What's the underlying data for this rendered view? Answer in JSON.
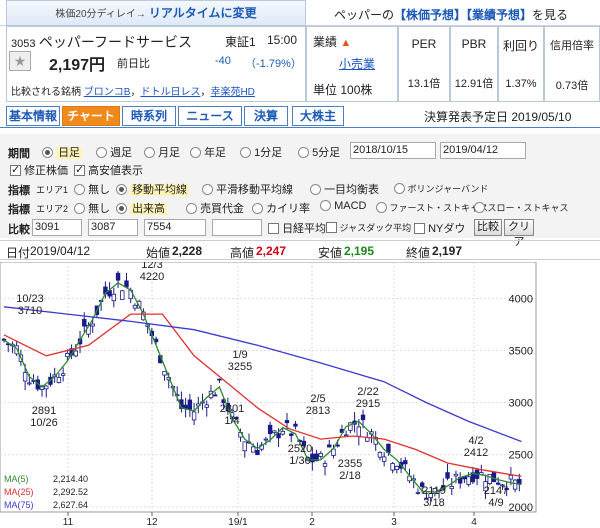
{
  "header": {
    "delay_note": "株価20分ディレイ→",
    "realtime_link": "リアルタイムに変更",
    "forecast_prefix": "ペッパーの",
    "stock_forecast_link": "【株価予想】",
    "earnings_forecast_link": "【業績予想】",
    "forecast_suffix": "を見る"
  },
  "quote": {
    "code": "3053",
    "name": "ペッパーフードサービス",
    "market": "東証1",
    "time": "15:00",
    "price": "2,197円",
    "change_label": "前日比",
    "change": "-40",
    "change_pct": "（-1.79%）",
    "compare_label": "比較される銘柄",
    "compare_stocks": [
      "ブロンコB",
      "ドトル日レス",
      "幸楽苑HD"
    ],
    "sector_label": "業績",
    "sector_value": "小売業",
    "unit_label": "単位",
    "unit_value": "100株"
  },
  "metrics": {
    "headers": [
      "PER",
      "PBR",
      "利回り",
      "信用倍率"
    ],
    "values": [
      "13.1倍",
      "12.91倍",
      "1.37%",
      "0.73倍"
    ]
  },
  "tabs": [
    "基本情報",
    "チャート",
    "時系列",
    "ニュース",
    "決算",
    "大株主"
  ],
  "earnings_date": "決算発表予定日 2019/05/10",
  "controls": {
    "period_label": "期間",
    "periods": [
      "日足",
      "週足",
      "月足",
      "年足",
      "1分足",
      "5分足"
    ],
    "date_from": "2018/10/15",
    "date_to": "2019/04/12",
    "adjusted_label": "修正株価",
    "hilo_label": "高安値表示",
    "indicator_label": "指標",
    "area1": "エリア1",
    "area1_options": [
      "無し",
      "移動平均線",
      "平滑移動平均線",
      "一目均衡表",
      "ボリンジャーバンド"
    ],
    "area2": "エリア2",
    "area2_options": [
      "無し",
      "出来高",
      "売買代金",
      "カイリ率",
      "MACD",
      "ファースト・ストキャス",
      "スロー・ストキャス"
    ],
    "compare_label": "比較",
    "compare_codes": [
      "3091",
      "3087",
      "7554",
      ""
    ],
    "nikkei_label": "日経平均",
    "jasdaq_label": "ジャスダック平均",
    "ny_label": "NYダウ",
    "compare_btn": "比較",
    "clear_btn": "クリア"
  },
  "ohlc": {
    "date_label": "日付",
    "date": "2019/04/12",
    "open_label": "始値",
    "open": "2,228",
    "high_label": "高値",
    "high": "2,247",
    "low_label": "安値",
    "low": "2,195",
    "close_label": "終値",
    "close": "2,197"
  },
  "chart_data": {
    "type": "line",
    "y_ticks": [
      "4000",
      "3500",
      "3000",
      "2500",
      "2000"
    ],
    "ylim": [
      1950,
      4350
    ],
    "x_labels": [
      "11",
      "12",
      "19/1",
      "2",
      "3",
      "4"
    ],
    "annotations": [
      {
        "label": "10/23",
        "value": "3710"
      },
      {
        "label": "2891",
        "value": "10/26"
      },
      {
        "label": "12/3",
        "value": "4220"
      },
      {
        "label": "1/9",
        "value": "3255"
      },
      {
        "label": "2801",
        "value": "1/4"
      },
      {
        "label": "2/5",
        "value": "2813"
      },
      {
        "label": "2520",
        "value": "1/30"
      },
      {
        "label": "2/22",
        "value": "2915"
      },
      {
        "label": "2355",
        "value": "2/18"
      },
      {
        "label": "4/2",
        "value": "2412"
      },
      {
        "label": "2119",
        "value": "3/18"
      },
      {
        "label": "2147",
        "value": "4/9"
      }
    ],
    "ma_legend": [
      {
        "name": "MA(5)",
        "value": "2,214.40",
        "color": "#2e8b2e"
      },
      {
        "name": "MA(25)",
        "value": "2,292.52",
        "color": "#e03030"
      },
      {
        "name": "MA(75)",
        "value": "2,627.64",
        "color": "#3a3ad0"
      }
    ],
    "series": [
      {
        "name": "MA(5)",
        "color": "#2e8b2e",
        "points": [
          [
            0,
            3600
          ],
          [
            6,
            3520
          ],
          [
            12,
            3250
          ],
          [
            18,
            3150
          ],
          [
            24,
            3250
          ],
          [
            30,
            3400
          ],
          [
            36,
            3600
          ],
          [
            42,
            3800
          ],
          [
            48,
            4050
          ],
          [
            54,
            4150
          ],
          [
            60,
            4080
          ],
          [
            66,
            3850
          ],
          [
            72,
            3550
          ],
          [
            78,
            3250
          ],
          [
            84,
            2950
          ],
          [
            90,
            2920
          ],
          [
            96,
            3050
          ],
          [
            102,
            3150
          ],
          [
            108,
            2850
          ],
          [
            114,
            2650
          ],
          [
            120,
            2560
          ],
          [
            126,
            2640
          ],
          [
            132,
            2760
          ],
          [
            138,
            2700
          ],
          [
            144,
            2450
          ],
          [
            150,
            2450
          ],
          [
            156,
            2560
          ],
          [
            162,
            2770
          ],
          [
            168,
            2820
          ],
          [
            174,
            2700
          ],
          [
            180,
            2550
          ],
          [
            186,
            2450
          ],
          [
            192,
            2300
          ],
          [
            198,
            2150
          ],
          [
            204,
            2140
          ],
          [
            210,
            2200
          ],
          [
            216,
            2280
          ],
          [
            222,
            2320
          ],
          [
            228,
            2300
          ],
          [
            234,
            2260
          ],
          [
            240,
            2230
          ],
          [
            245,
            2214
          ]
        ]
      },
      {
        "name": "MA(25)",
        "color": "#e03030",
        "points": [
          [
            0,
            3650
          ],
          [
            20,
            3450
          ],
          [
            40,
            3550
          ],
          [
            60,
            3850
          ],
          [
            75,
            3850
          ],
          [
            90,
            3450
          ],
          [
            105,
            3200
          ],
          [
            120,
            2950
          ],
          [
            135,
            2750
          ],
          [
            150,
            2650
          ],
          [
            165,
            2680
          ],
          [
            180,
            2650
          ],
          [
            195,
            2550
          ],
          [
            210,
            2420
          ],
          [
            225,
            2360
          ],
          [
            245,
            2292
          ]
        ]
      },
      {
        "name": "MA(75)",
        "color": "#3a3ad0",
        "points": [
          [
            0,
            3920
          ],
          [
            30,
            3850
          ],
          [
            60,
            3780
          ],
          [
            90,
            3700
          ],
          [
            120,
            3550
          ],
          [
            150,
            3380
          ],
          [
            180,
            3200
          ],
          [
            200,
            3000
          ],
          [
            220,
            2820
          ],
          [
            245,
            2627
          ]
        ]
      }
    ]
  }
}
